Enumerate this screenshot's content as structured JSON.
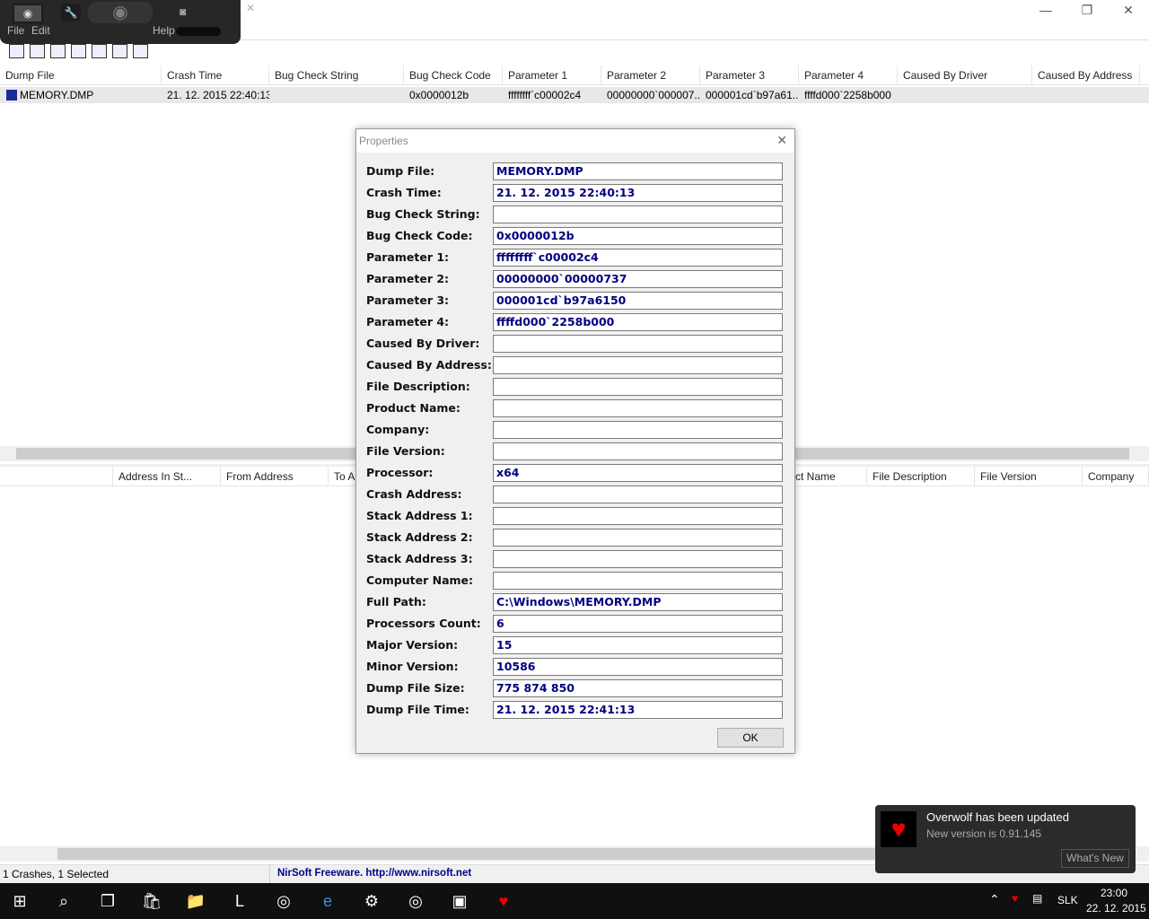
{
  "window": {
    "title": "BlueScreenView",
    "close": "✕",
    "maximize": "❐",
    "minimize": "—"
  },
  "menu": [
    "File",
    "Edit",
    "Help"
  ],
  "toolbar": [
    "properties",
    "save",
    "refresh",
    "copy",
    "html-report",
    "find",
    "exit"
  ],
  "upper": {
    "columns": [
      "Dump File",
      "Crash Time",
      "Bug Check String",
      "Bug Check Code",
      "Parameter 1",
      "Parameter 2",
      "Parameter 3",
      "Parameter 4",
      "Caused By Driver",
      "Caused By Address"
    ],
    "rows": [
      [
        "MEMORY.DMP",
        "21. 12. 2015 22:40:13",
        "",
        "0x0000012b",
        "ffffffff`c00002c4",
        "00000000`000007...",
        "000001cd`b97a61...",
        "ffffd000`2258b000",
        "",
        ""
      ]
    ]
  },
  "lower": {
    "columns": [
      "",
      "Address In St...",
      "From Address",
      "To A...",
      "",
      "",
      "ct Name",
      "File Description",
      "File Version",
      "Company"
    ]
  },
  "dialog": {
    "title": "Properties",
    "ok": "OK",
    "fields": [
      [
        "Dump File:",
        "MEMORY.DMP"
      ],
      [
        "Crash Time:",
        "21. 12. 2015 22:40:13"
      ],
      [
        "Bug Check String:",
        ""
      ],
      [
        "Bug Check Code:",
        "0x0000012b"
      ],
      [
        "Parameter 1:",
        "ffffffff`c00002c4"
      ],
      [
        "Parameter 2:",
        "00000000`00000737"
      ],
      [
        "Parameter 3:",
        "000001cd`b97a6150"
      ],
      [
        "Parameter 4:",
        "ffffd000`2258b000"
      ],
      [
        "Caused By Driver:",
        ""
      ],
      [
        "Caused By Address:",
        ""
      ],
      [
        "File Description:",
        ""
      ],
      [
        "Product Name:",
        ""
      ],
      [
        "Company:",
        ""
      ],
      [
        "File Version:",
        ""
      ],
      [
        "Processor:",
        "x64"
      ],
      [
        "Crash Address:",
        ""
      ],
      [
        "Stack Address 1:",
        ""
      ],
      [
        "Stack Address 2:",
        ""
      ],
      [
        "Stack Address 3:",
        ""
      ],
      [
        "Computer Name:",
        ""
      ],
      [
        "Full Path:",
        "C:\\Windows\\MEMORY.DMP"
      ],
      [
        "Processors Count:",
        "6"
      ],
      [
        "Major Version:",
        "15"
      ],
      [
        "Minor Version:",
        "10586"
      ],
      [
        "Dump File Size:",
        "775 874 850"
      ],
      [
        "Dump File Time:",
        "21. 12. 2015 22:41:13"
      ]
    ]
  },
  "status": {
    "count": "1 Crashes, 1 Selected",
    "nirsoft": "NirSoft Freeware.  http://www.nirsoft.net"
  },
  "toast": {
    "title": "Overwolf has been updated",
    "body": "New version is 0.91.145",
    "button": "What's New"
  },
  "tray": {
    "lang": "SLK",
    "time": "23:00",
    "date": "22. 12. 2015"
  },
  "taskbar": [
    "start",
    "search",
    "task-view",
    "store",
    "file-explorer",
    "league",
    "chrome",
    "edge",
    "settings",
    "chrome-alt",
    "bluescreenview",
    "overwolf"
  ]
}
